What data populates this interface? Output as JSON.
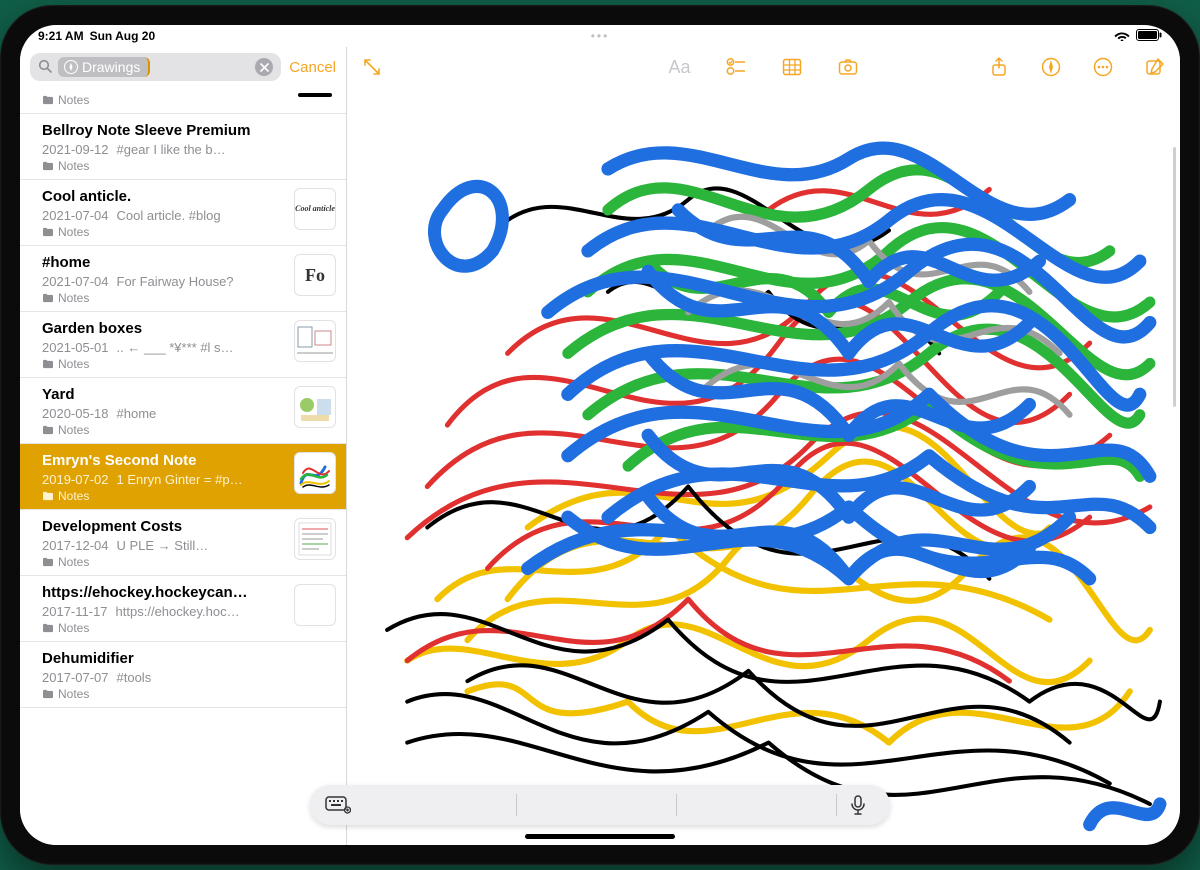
{
  "status": {
    "time": "9:21 AM",
    "date": "Sun Aug 20"
  },
  "search": {
    "token": "Drawings",
    "cancel": "Cancel"
  },
  "folder_label": "Notes",
  "toolbar": {
    "expand": "expand",
    "aa": "Aa",
    "checklist": "checklist",
    "table": "table",
    "camera": "camera",
    "share": "share",
    "markup": "markup",
    "more": "more",
    "compose": "compose"
  },
  "notes": [
    {
      "title": "",
      "date": "",
      "snippet": "",
      "thumb": "blackline",
      "first": true
    },
    {
      "title": "Bellroy Note Sleeve Premium",
      "date": "2021-09-12",
      "snippet": "#gear    I like the b…"
    },
    {
      "title": "Cool anticle.",
      "date": "2021-07-04",
      "snippet": "Cool article. #blog",
      "thumb": "cool"
    },
    {
      "title": "#home",
      "date": "2021-07-04",
      "snippet": "For Fairway House?",
      "thumb": "fo"
    },
    {
      "title": "Garden boxes",
      "date": "2021-05-01",
      "snippet": ".. ← ___ *¥*** #l s…",
      "thumb": "plan"
    },
    {
      "title": "Yard",
      "date": "2020-05-18",
      "snippet": "#home",
      "thumb": "yard"
    },
    {
      "title": "Emryn's Second Note",
      "date": "2019-07-02",
      "snippet": "1 Enryn Ginter = #p…",
      "thumb": "scribble",
      "selected": true
    },
    {
      "title": "Development Costs",
      "date": "2017-12-04",
      "snippet": "U PLE → Still…",
      "thumb": "doc"
    },
    {
      "title": "https://ehockey.hockeycan…",
      "date": "2017-11-17",
      "snippet": "https://ehockey.hoc…",
      "thumb": "blank"
    },
    {
      "title": "Dehumidifier",
      "date": "2017-07-07",
      "snippet": "#tools"
    }
  ]
}
